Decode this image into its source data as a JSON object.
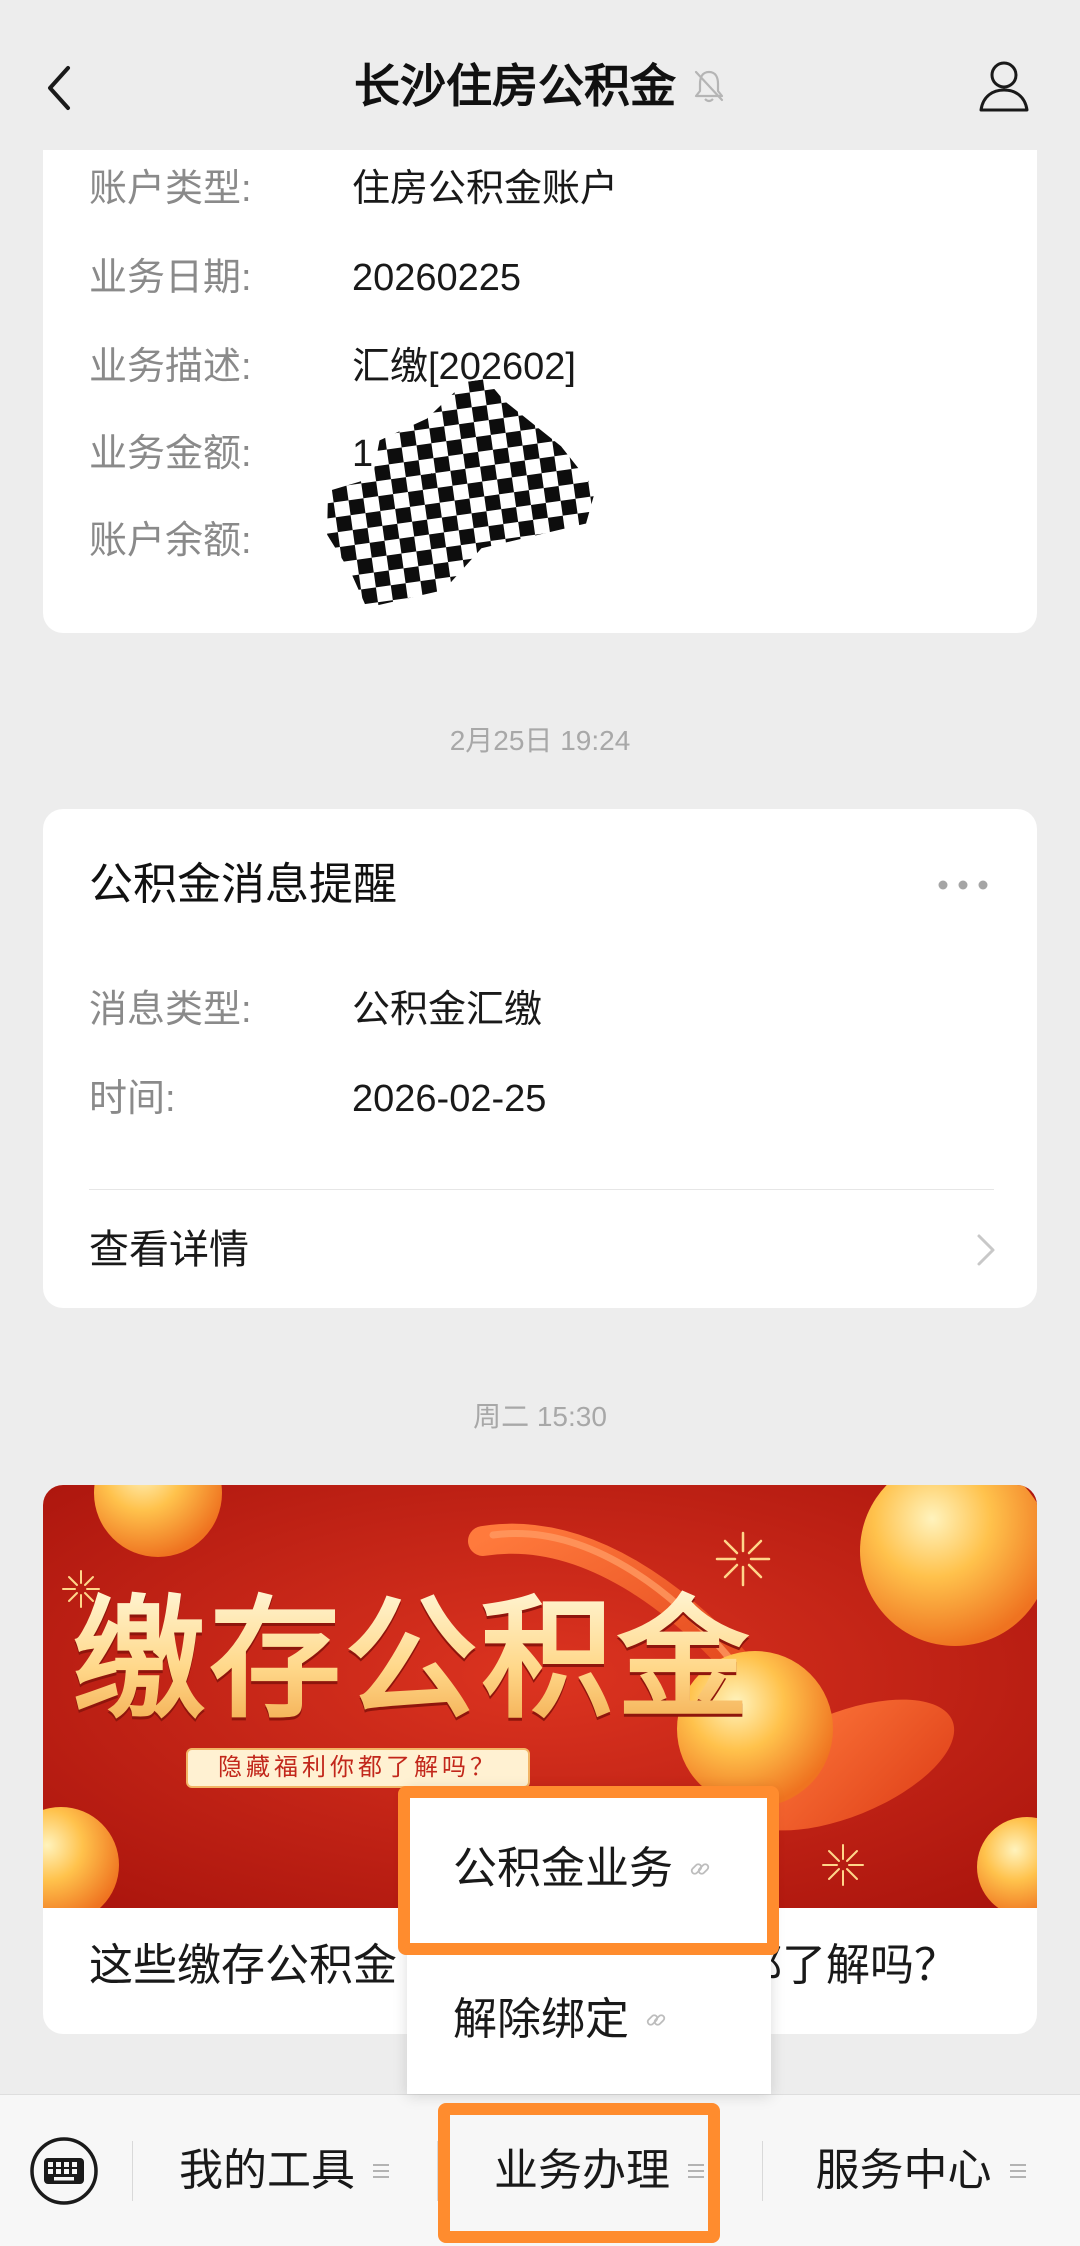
{
  "header": {
    "title": "长沙住房公积金",
    "back_icon": "chevron-left-icon",
    "mute_icon": "bell-muted-icon",
    "profile_icon": "person-icon"
  },
  "card1": {
    "rows": [
      {
        "label": "账户类型:",
        "value": "住房公积金账户"
      },
      {
        "label": "业务日期:",
        "value": "20260225"
      },
      {
        "label": "业务描述:",
        "value": "汇缴[202602]"
      },
      {
        "label": "业务金额:",
        "value": "1"
      },
      {
        "label": "账户余额:"
      }
    ]
  },
  "timestamp1": "2月25日 19:24",
  "card2": {
    "title": "公积金消息提醒",
    "more_icon": "more-dots-icon",
    "rows": [
      {
        "label": "消息类型:",
        "value": "公积金汇缴"
      },
      {
        "label": "时间:",
        "value": "2026-02-25"
      }
    ],
    "detail_link": "查看详情"
  },
  "timestamp2": "周二 15:30",
  "article": {
    "banner_title": "缴存公积金",
    "banner_tag": "隐藏福利你都了解吗？",
    "caption_left": "这些缴存公积金",
    "caption_right": "都了解吗？"
  },
  "popup_menu": {
    "items": [
      {
        "label": "公积金业务",
        "icon": "link-icon"
      },
      {
        "label": "解除绑定",
        "icon": "link-icon"
      }
    ]
  },
  "bottom_menu": {
    "keyboard_icon": "keyboard-icon",
    "items": [
      {
        "label": "我的工具",
        "icon": "menu-lines-icon"
      },
      {
        "label": "业务办理",
        "icon": "menu-lines-icon"
      },
      {
        "label": "服务中心",
        "icon": "menu-lines-icon"
      }
    ]
  },
  "colors": {
    "background": "#ededed",
    "card": "#ffffff",
    "highlight": "#ff8c2e",
    "banner_red": "#c8231a"
  }
}
